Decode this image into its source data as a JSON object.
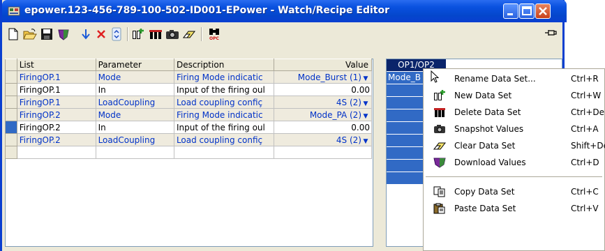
{
  "window": {
    "title": "epower.123-456-789-100-502-ID001-EPower - Watch/Recipe Editor"
  },
  "toolbar": {
    "items": [
      "new-file-icon",
      "open-folder-icon",
      "save-disk-icon",
      "download-shield-icon",
      "move-down-icon",
      "delete-x-icon",
      "scroll-updown-icon",
      "new-dataset-icon",
      "delete-dataset-icon",
      "snapshot-camera-icon",
      "eraser-icon",
      "opc-binoculars-icon"
    ]
  },
  "grid": {
    "headers": {
      "list": "List",
      "parameter": "Parameter",
      "description": "Description",
      "value": "Value"
    },
    "rows": [
      {
        "list": "FiringOP.1",
        "parameter": "Mode",
        "description": "Firing Mode indicatic",
        "value": "Mode_Burst (1)",
        "dropdown": true
      },
      {
        "list": "FiringOP.1",
        "parameter": "In",
        "description": "Input of the firing oul",
        "value": "0.00",
        "dropdown": false
      },
      {
        "list": "FiringOP.1",
        "parameter": "LoadCoupling",
        "description": "Load coupling confiç",
        "value": "4S (2)",
        "dropdown": true
      },
      {
        "list": "FiringOP.2",
        "parameter": "Mode",
        "description": "Firing Mode indicatic",
        "value": "Mode_PA (2)",
        "dropdown": true
      },
      {
        "list": "FiringOP.2",
        "parameter": "In",
        "description": "Input of the firing oul",
        "value": "0.00",
        "dropdown": false
      },
      {
        "list": "FiringOP.2",
        "parameter": "LoadCoupling",
        "description": "Load coupling confiç",
        "value": "4S (2)",
        "dropdown": true
      }
    ]
  },
  "dataset": {
    "header": "OP1/OP2",
    "first_cell": "Mode_B"
  },
  "context_menu": {
    "items": [
      {
        "label": "Rename Data Set...",
        "shortcut": "Ctrl+R",
        "icon": "none"
      },
      {
        "label": "New Data Set",
        "shortcut": "Ctrl+W",
        "icon": "new-dataset-icon"
      },
      {
        "label": "Delete Data Set",
        "shortcut": "Ctrl+Del",
        "icon": "delete-dataset-icon"
      },
      {
        "label": "Snapshot Values",
        "shortcut": "Ctrl+A",
        "icon": "camera-icon"
      },
      {
        "label": "Clear Data Set",
        "shortcut": "Shift+Del",
        "icon": "eraser-icon"
      },
      {
        "label": "Download Values",
        "shortcut": "Ctrl+D",
        "icon": "download-shield-icon"
      },
      {
        "label": "Copy Data Set",
        "shortcut": "Ctrl+C",
        "icon": "copy-icon"
      },
      {
        "label": "Paste Data Set",
        "shortcut": "Ctrl+V",
        "icon": "paste-icon"
      }
    ]
  },
  "colors": {
    "title_bar": "#0a52e0",
    "selection": "#316ac5",
    "link_text": "#0032c8",
    "alt_row": "#efebde"
  }
}
